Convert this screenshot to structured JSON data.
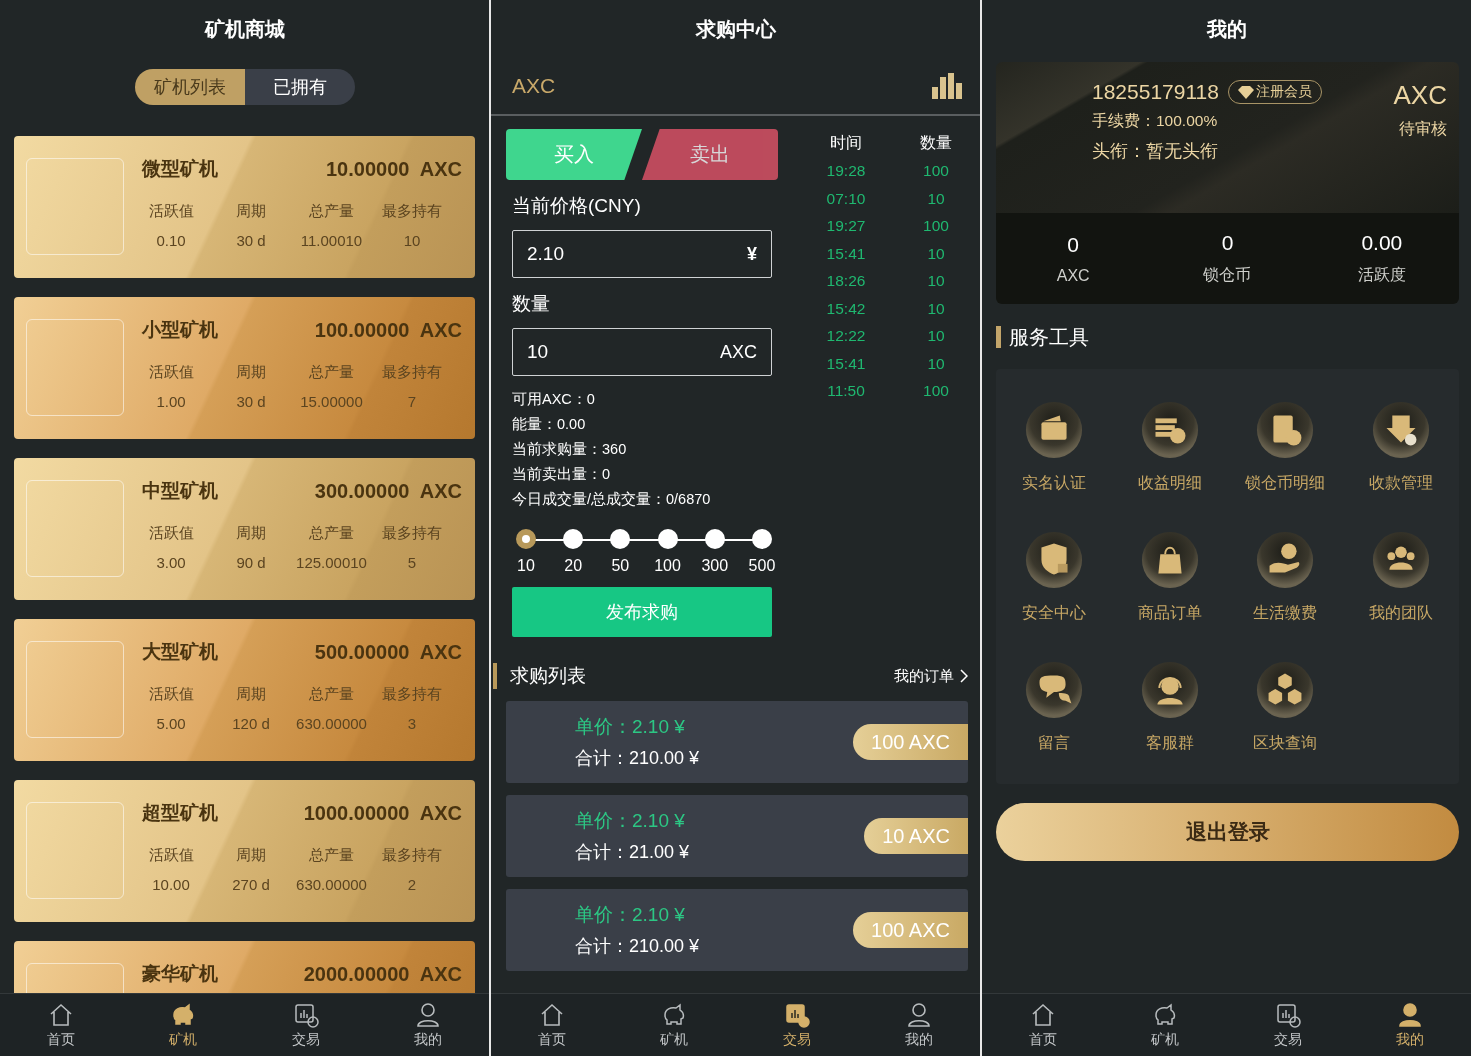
{
  "mall": {
    "title": "矿机商城",
    "tabs": [
      {
        "label": "矿机列表",
        "selected": true
      },
      {
        "label": "已拥有",
        "selected": false
      }
    ],
    "machines": [
      {
        "name": "微型矿机",
        "price": "10.00000  AXC",
        "stats": [
          {
            "label": "活跃值",
            "value": "0.10"
          },
          {
            "label": "周期",
            "value": "30 d"
          },
          {
            "label": "总产量",
            "value": "11.00010"
          },
          {
            "label": "最多持有",
            "value": "10"
          }
        ]
      },
      {
        "name": "小型矿机",
        "price": "100.00000  AXC",
        "stats": [
          {
            "label": "活跃值",
            "value": "1.00"
          },
          {
            "label": "周期",
            "value": "30 d"
          },
          {
            "label": "总产量",
            "value": "15.00000"
          },
          {
            "label": "最多持有",
            "value": "7"
          }
        ]
      },
      {
        "name": "中型矿机",
        "price": "300.00000  AXC",
        "stats": [
          {
            "label": "活跃值",
            "value": "3.00"
          },
          {
            "label": "周期",
            "value": "90 d"
          },
          {
            "label": "总产量",
            "value": "125.00010"
          },
          {
            "label": "最多持有",
            "value": "5"
          }
        ]
      },
      {
        "name": "大型矿机",
        "price": "500.00000  AXC",
        "stats": [
          {
            "label": "活跃值",
            "value": "5.00"
          },
          {
            "label": "周期",
            "value": "120 d"
          },
          {
            "label": "总产量",
            "value": "630.00000"
          },
          {
            "label": "最多持有",
            "value": "3"
          }
        ]
      },
      {
        "name": "超型矿机",
        "price": "1000.00000  AXC",
        "stats": [
          {
            "label": "活跃值",
            "value": "10.00"
          },
          {
            "label": "周期",
            "value": "270 d"
          },
          {
            "label": "总产量",
            "value": "630.00000"
          },
          {
            "label": "最多持有",
            "value": "2"
          }
        ]
      },
      {
        "name": "豪华矿机",
        "price": "2000.00000  AXC"
      }
    ],
    "nav": [
      {
        "label": "首页",
        "selected": false
      },
      {
        "label": "矿机",
        "selected": true
      },
      {
        "label": "交易",
        "selected": false
      },
      {
        "label": "我的",
        "selected": false
      }
    ]
  },
  "purchase": {
    "title": "求购中心",
    "coin": "AXC",
    "trade_tabs": [
      {
        "label": "买入",
        "kind": "buy",
        "selected": true
      },
      {
        "label": "卖出",
        "kind": "sell",
        "selected": false
      }
    ],
    "price_label": "当前价格(CNY)",
    "price_value": "2.10",
    "price_unit": "¥",
    "amount_label": "数量",
    "amount_value": "10",
    "amount_unit": "AXC",
    "info": [
      "可用AXC：0",
      "能量：0.00",
      "当前求购量：360",
      "当前卖出量：0",
      "今日成交量/总成交量：0/6870"
    ],
    "quick_amounts": [
      {
        "label": "10",
        "selected": true
      },
      {
        "label": "20",
        "selected": false
      },
      {
        "label": "50",
        "selected": false
      },
      {
        "label": "100",
        "selected": false
      },
      {
        "label": "300",
        "selected": false
      },
      {
        "label": "500",
        "selected": false
      }
    ],
    "submit": "发布求购",
    "history": {
      "columns": [
        "时间",
        "数量"
      ],
      "rows": [
        [
          "19:28",
          "100"
        ],
        [
          "07:10",
          "10"
        ],
        [
          "19:27",
          "100"
        ],
        [
          "15:41",
          "10"
        ],
        [
          "18:26",
          "10"
        ],
        [
          "15:42",
          "10"
        ],
        [
          "12:22",
          "10"
        ],
        [
          "15:41",
          "10"
        ],
        [
          "11:50",
          "100"
        ]
      ]
    },
    "list_title": "求购列表",
    "my_orders": "我的订单",
    "orders": [
      {
        "unit_price": "单价：2.10 ¥",
        "total": "合计：210.00 ¥",
        "amount": "100 AXC"
      },
      {
        "unit_price": "单价：2.10 ¥",
        "total": "合计：21.00 ¥",
        "amount": "10 AXC"
      },
      {
        "unit_price": "单价：2.10 ¥",
        "total": "合计：210.00 ¥",
        "amount": "100 AXC"
      }
    ],
    "nav": [
      {
        "label": "首页",
        "selected": false
      },
      {
        "label": "矿机",
        "selected": false
      },
      {
        "label": "交易",
        "selected": true
      },
      {
        "label": "我的",
        "selected": false
      }
    ]
  },
  "profile": {
    "title": "我的",
    "phone": "18255179118",
    "badge": "注册会员",
    "fee": "手续费：100.00%",
    "rank": "头衔：暂无头衔",
    "coin": "AXC",
    "status": "待审核",
    "stats": [
      {
        "value": "0",
        "label": "AXC"
      },
      {
        "value": "0",
        "label": "锁仓币"
      },
      {
        "value": "0.00",
        "label": "活跃度"
      }
    ],
    "section_title": "服务工具",
    "tools": [
      "实名认证",
      "收益明细",
      "锁仓币明细",
      "收款管理",
      "安全中心",
      "商品订单",
      "生活缴费",
      "我的团队",
      "留言",
      "客服群",
      "区块查询"
    ],
    "logout": "退出登录",
    "nav": [
      {
        "label": "首页",
        "selected": false
      },
      {
        "label": "矿机",
        "selected": false
      },
      {
        "label": "交易",
        "selected": false
      },
      {
        "label": "我的",
        "selected": true
      }
    ]
  }
}
